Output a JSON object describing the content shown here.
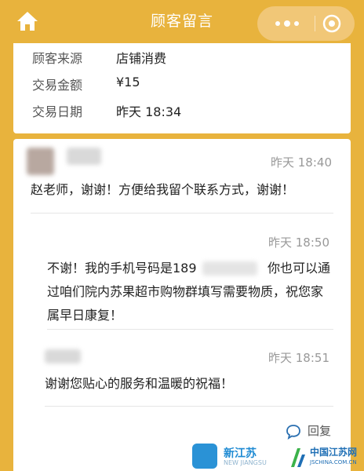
{
  "header": {
    "title": "顾客留言",
    "more_icon": "more-dots-icon",
    "target_icon": "target-icon"
  },
  "order": {
    "source_label": "顾客来源",
    "source_value": "店铺消费",
    "amount_label": "交易金额",
    "amount_value": "¥15",
    "date_label": "交易日期",
    "date_value": "昨天 18:34"
  },
  "messages": [
    {
      "time": "昨天 18:40",
      "text": "赵老师，谢谢！方便给我留个联系方式，谢谢！"
    },
    {
      "time": "昨天 18:50",
      "line1": "不谢！我的手机号码是189",
      "line1_tail": "你也可以通",
      "line2": "过咱们院内苏果超市购物群填写需要物质，祝您家",
      "line3": "属早日康复！"
    },
    {
      "time": "昨天 18:51",
      "text": "谢谢您贴心的服务和温暖的祝福！"
    }
  ],
  "reply_label": "回复",
  "watermarks": {
    "left_title": "新江苏",
    "left_sub": "NEW JIANGSU",
    "right_title": "中国江苏网",
    "right_sub": "JSCHINA.COM.CN"
  },
  "colors": {
    "brand": "#e8b33d",
    "card": "#ffffff",
    "muted": "#999999"
  }
}
